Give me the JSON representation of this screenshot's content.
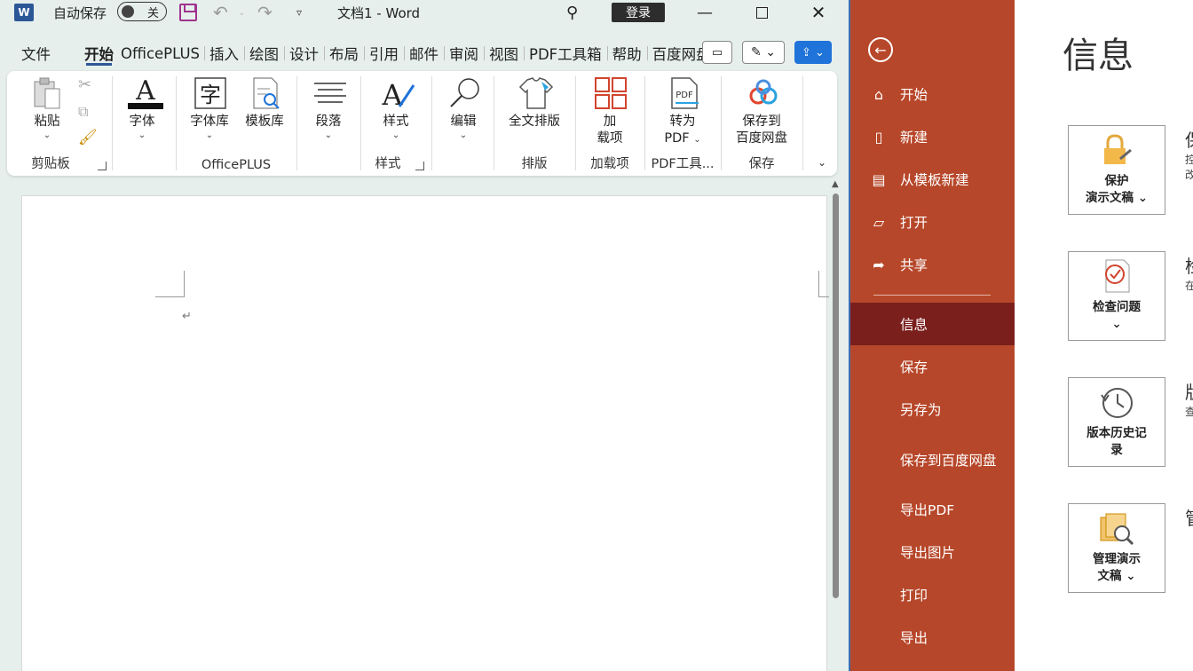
{
  "titlebar": {
    "autosave_label": "自动保存",
    "autosave_state": "关",
    "doc_title": "文档1  -  Word",
    "login_label": "登录",
    "logo_letter": "W"
  },
  "tabs": [
    "文件",
    "开始",
    "OfficePLUS",
    "插入",
    "绘图",
    "设计",
    "布局",
    "引用",
    "邮件",
    "审阅",
    "视图",
    "PDF工具箱",
    "帮助",
    "百度网盘"
  ],
  "ribbon": {
    "clipboard": {
      "paste": "粘贴",
      "group": "剪贴板"
    },
    "font": {
      "label": "字体"
    },
    "officeplus": {
      "fontlib": "字体库",
      "templatelib": "模板库",
      "group": "OfficePLUS"
    },
    "paragraph": {
      "label": "段落"
    },
    "styles": {
      "label": "样式",
      "group": "样式"
    },
    "editing": {
      "label": "编辑"
    },
    "layout": {
      "label": "全文排版",
      "group": "排版"
    },
    "addins": {
      "line1": "加",
      "line2": "载项",
      "group": "加载项"
    },
    "pdf": {
      "line1": "转为",
      "line2": "PDF",
      "group": "PDF工具..."
    },
    "save": {
      "line1": "保存到",
      "line2": "百度网盘",
      "group": "保存"
    }
  },
  "document": {
    "paragraph_mark": "↵"
  },
  "backstage": {
    "nav": {
      "home": "开始",
      "new": "新建",
      "from_template": "从模板新建",
      "open": "打开",
      "share": "共享",
      "info": "信息",
      "save": "保存",
      "save_as": "另存为",
      "save_baidu": "保存到百度网盘",
      "export_pdf": "导出PDF",
      "export_image": "导出图片",
      "print": "打印",
      "export": "导出"
    },
    "title": "信息",
    "cards": {
      "protect": {
        "line1": "保护",
        "line2": "演示文稿"
      },
      "inspect": {
        "line1": "检查问题"
      },
      "history": {
        "line1": "版本历史记",
        "line2": "录"
      },
      "manage": {
        "line1": "管理演示",
        "line2": "文稿"
      }
    }
  },
  "colors": {
    "nav_bg": "#b7472a",
    "nav_selected": "#7a1f1c",
    "word_blue": "#2b5797",
    "share_blue": "#1f73d9"
  }
}
